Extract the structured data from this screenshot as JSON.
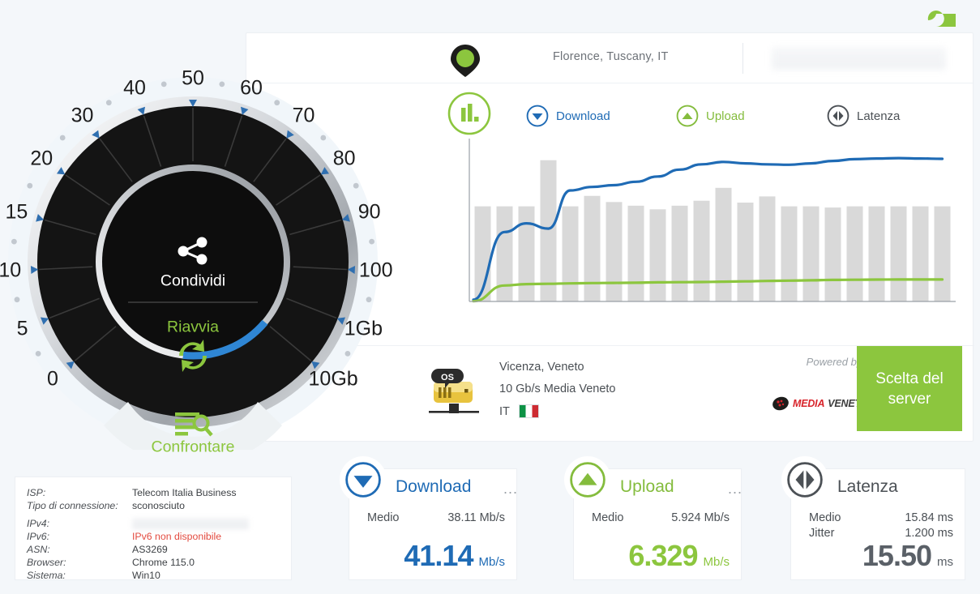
{
  "header": {
    "settings_icon": "wrench-icon",
    "location": "Florence, Tuscany, IT",
    "location_pin_icon": "map-pin-icon",
    "ip_redacted": ""
  },
  "legend": {
    "chart_icon": "bar-chart-icon",
    "items": [
      {
        "label": "Download",
        "icon": "download-arrow-icon",
        "color": "#1f6bb5"
      },
      {
        "label": "Upload",
        "icon": "upload-arrow-icon",
        "color": "#84bc3d"
      },
      {
        "label": "Latenza",
        "icon": "latency-icon",
        "color": "#4c5156"
      }
    ]
  },
  "chart_data": {
    "type": "line",
    "title": "",
    "xlabel": "",
    "ylabel": "",
    "grid": false,
    "legend_position": "top",
    "x": [
      0,
      1,
      2,
      3,
      4,
      5,
      6,
      7,
      8,
      9,
      10,
      11,
      12,
      13,
      14,
      15,
      16,
      17,
      18,
      19,
      20,
      21
    ],
    "series": [
      {
        "name": "Latenza",
        "type": "bar",
        "color": "#d9d9d9",
        "values": [
          15.5,
          15.5,
          15.5,
          23.0,
          15.5,
          17.2,
          16.2,
          15.6,
          15.0,
          15.6,
          16.4,
          18.5,
          16.1,
          17.1,
          15.5,
          15.5,
          15.3,
          15.5,
          15.5,
          15.5,
          15.5,
          15.5
        ]
      },
      {
        "name": "Download",
        "type": "line",
        "color": "#1f6bb5",
        "values": [
          0.5,
          20.0,
          22.5,
          21.0,
          32.0,
          33.0,
          33.5,
          34.5,
          36.0,
          38.0,
          39.5,
          40.2,
          39.8,
          39.5,
          39.4,
          39.8,
          40.5,
          41.0,
          41.2,
          41.3,
          41.2,
          41.1
        ]
      },
      {
        "name": "Upload",
        "type": "line",
        "color": "#8cc63e",
        "values": [
          0.1,
          4.6,
          5.0,
          5.1,
          5.2,
          5.3,
          5.35,
          5.4,
          5.5,
          5.55,
          5.6,
          5.7,
          5.8,
          5.9,
          6.0,
          6.1,
          6.2,
          6.25,
          6.3,
          6.32,
          6.33,
          6.33
        ]
      }
    ]
  },
  "gauge": {
    "ticks": [
      "0",
      "5",
      "10",
      "15",
      "20",
      "30",
      "40",
      "50",
      "60",
      "70",
      "80",
      "90",
      "100",
      "1Gb",
      "10Gb"
    ],
    "share_label": "Condividi",
    "share_icon": "share-icon",
    "restart_label": "Riavvia",
    "restart_icon": "refresh-icon",
    "compare_label": "Confrontare",
    "compare_icon": "compare-search-icon"
  },
  "server": {
    "icon": "server-os-icon",
    "city": "Vicenza, Veneto",
    "speed": "10 Gb/s Media Veneto",
    "country_code": "IT",
    "flag_icon": "italy-flag-icon",
    "powered_by": "Powered by",
    "provider_brand_a": "MEDIA",
    "provider_brand_b": "VENETO",
    "choose_button": "Scelta del server"
  },
  "isp": {
    "rows": [
      {
        "key": "ISP:",
        "value": "Telecom Italia Business",
        "style": "normal"
      },
      {
        "key": "Tipo di connessione:",
        "value": "sconosciuto",
        "style": "normal"
      },
      {
        "key": "IPv4:",
        "value": "",
        "style": "blurred"
      },
      {
        "key": "IPv6:",
        "value": "IPv6 non disponibile",
        "style": "red"
      },
      {
        "key": "ASN:",
        "value": "AS3269",
        "style": "normal"
      },
      {
        "key": "Browser:",
        "value": "Chrome 115.0",
        "style": "normal"
      },
      {
        "key": "Sistema:",
        "value": "Win10",
        "style": "normal"
      }
    ]
  },
  "results": {
    "download": {
      "title": "Download",
      "icon": "download-arrow-icon",
      "menu": "...",
      "avg_label": "Medio",
      "avg_value": "38.11 Mb/s",
      "value": "41.14",
      "unit": "Mb/s"
    },
    "upload": {
      "title": "Upload",
      "icon": "upload-arrow-icon",
      "menu": "...",
      "avg_label": "Medio",
      "avg_value": "5.924 Mb/s",
      "value": "6.329",
      "unit": "Mb/s"
    },
    "latency": {
      "title": "Latenza",
      "icon": "latency-icon",
      "avg_label": "Medio",
      "avg_value": "15.84 ms",
      "jitter_label": "Jitter",
      "jitter_value": "1.200 ms",
      "value": "15.50",
      "unit": "ms"
    }
  },
  "colors": {
    "download": "#1f6bb5",
    "upload": "#8cc63e",
    "latency": "#d9d9d9",
    "accent_green": "#8cc63e",
    "background": "#f4f7fa"
  }
}
